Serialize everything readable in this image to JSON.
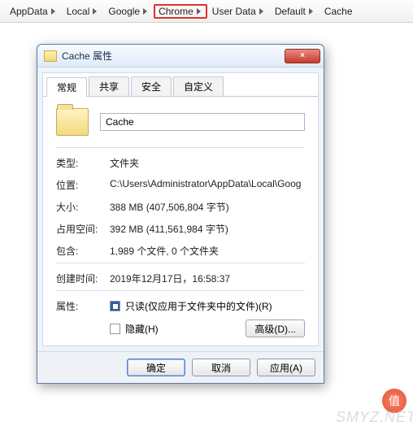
{
  "breadcrumb": {
    "items": [
      "AppData",
      "Local",
      "Google",
      "Chrome",
      "User Data",
      "Default",
      "Cache"
    ],
    "highlighted_index": 3
  },
  "dialog": {
    "title": "Cache 属性",
    "close_icon": "×",
    "tabs": [
      "常规",
      "共享",
      "安全",
      "自定义"
    ],
    "active_tab_index": 0,
    "folder_name": "Cache",
    "props": {
      "type_label": "类型:",
      "type_value": "文件夹",
      "location_label": "位置:",
      "location_value": "C:\\Users\\Administrator\\AppData\\Local\\Goog",
      "size_label": "大小:",
      "size_value": "388 MB (407,506,804 字节)",
      "ondisk_label": "占用空间:",
      "ondisk_value": "392 MB (411,561,984 字节)",
      "contains_label": "包含:",
      "contains_value": "1,989 个文件, 0 个文件夹",
      "created_label": "创建时间:",
      "created_value": "2019年12月17日，16:58:37",
      "attr_label": "属性:"
    },
    "attributes": {
      "readonly_checked": true,
      "readonly_label": "只读(仅应用于文件夹中的文件)(R)",
      "hidden_checked": false,
      "hidden_label": "隐藏(H)",
      "advanced_button": "高级(D)..."
    },
    "buttons": {
      "ok": "确定",
      "cancel": "取消",
      "apply": "应用(A)"
    }
  },
  "watermark": {
    "badge": "值",
    "text": "SMYZ.NET"
  }
}
